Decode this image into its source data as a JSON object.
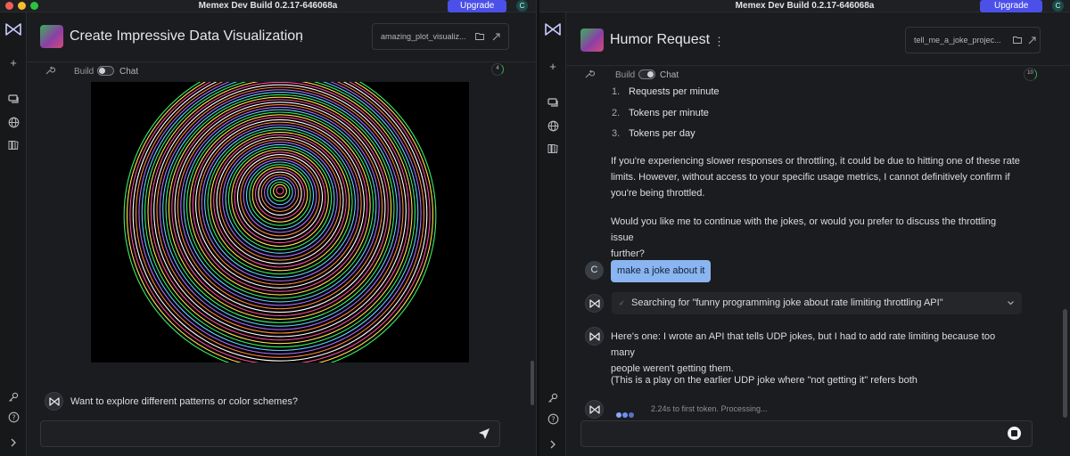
{
  "app": {
    "build_title": "Memex Dev Build 0.2.17-646068a",
    "upgrade_label": "Upgrade",
    "account_initial": "C"
  },
  "left": {
    "conversation_title": "Create Impressive Data Visualization",
    "file_chip": "amazing_plot_visualiz...",
    "mode_build": "Build",
    "mode_chat": "Chat",
    "context_count": "4",
    "plot": {
      "type": "multicolor concentric spiral on black background",
      "colors": [
        "#ff4da0",
        "#ffe14a",
        "#3cf06a",
        "#5fd0ff",
        "#b36bff",
        "#ff8a3c",
        "#ffffff"
      ]
    },
    "assistant_message": "Want to explore different patterns or color schemes?",
    "composer_placeholder": ""
  },
  "right": {
    "conversation_title": "Humor Request",
    "file_chip": "tell_me_a_joke_projec...",
    "mode_build": "Build",
    "mode_chat": "Chat",
    "context_count": "10",
    "rate_limits": [
      {
        "num": "1.",
        "label": "Requests per minute"
      },
      {
        "num": "2.",
        "label": "Tokens per minute"
      },
      {
        "num": "3.",
        "label": "Tokens per day"
      }
    ],
    "para_1_line_1": "If you're experiencing slower responses or throttling, it could be due to hitting one of these rate",
    "para_1_line_2": "limits. However, without access to your specific usage metrics, I cannot definitively confirm if",
    "para_1_line_3": "you're being throttled.",
    "para_2_line_1": "Would you like me to continue with the jokes, or would you prefer to discuss the throttling issue",
    "para_2_line_2": "further?",
    "user_initial": "C",
    "user_message": "make a joke about it",
    "tool_search": "Searching for \"funny programming joke about rate limiting throttling API\"",
    "joke_line_1": "Here's one: I wrote an API that tells UDP jokes, but I had to add rate limiting because too many",
    "joke_line_2": "people weren't getting them.",
    "joke_line_3": "(This is a play on the earlier UDP joke where \"not getting it\" refers both",
    "processing_text": "2.24s to first token. Processing..."
  },
  "colors": {
    "background": "#1b1c1f",
    "upgrade_button": "#4b50e8",
    "user_bubble": "#8ab5f0",
    "typing_dots": "#6c8ff5"
  },
  "icons": [
    "memex-logo-icon",
    "plus-icon",
    "chat-icon",
    "globe-icon",
    "library-icon",
    "key-icon",
    "help-icon",
    "expand-icon",
    "wrench-icon",
    "kebab-icon",
    "folder-icon",
    "open-external-icon",
    "send-icon",
    "stop-icon",
    "checkmark-icon",
    "chevron-down-icon"
  ]
}
